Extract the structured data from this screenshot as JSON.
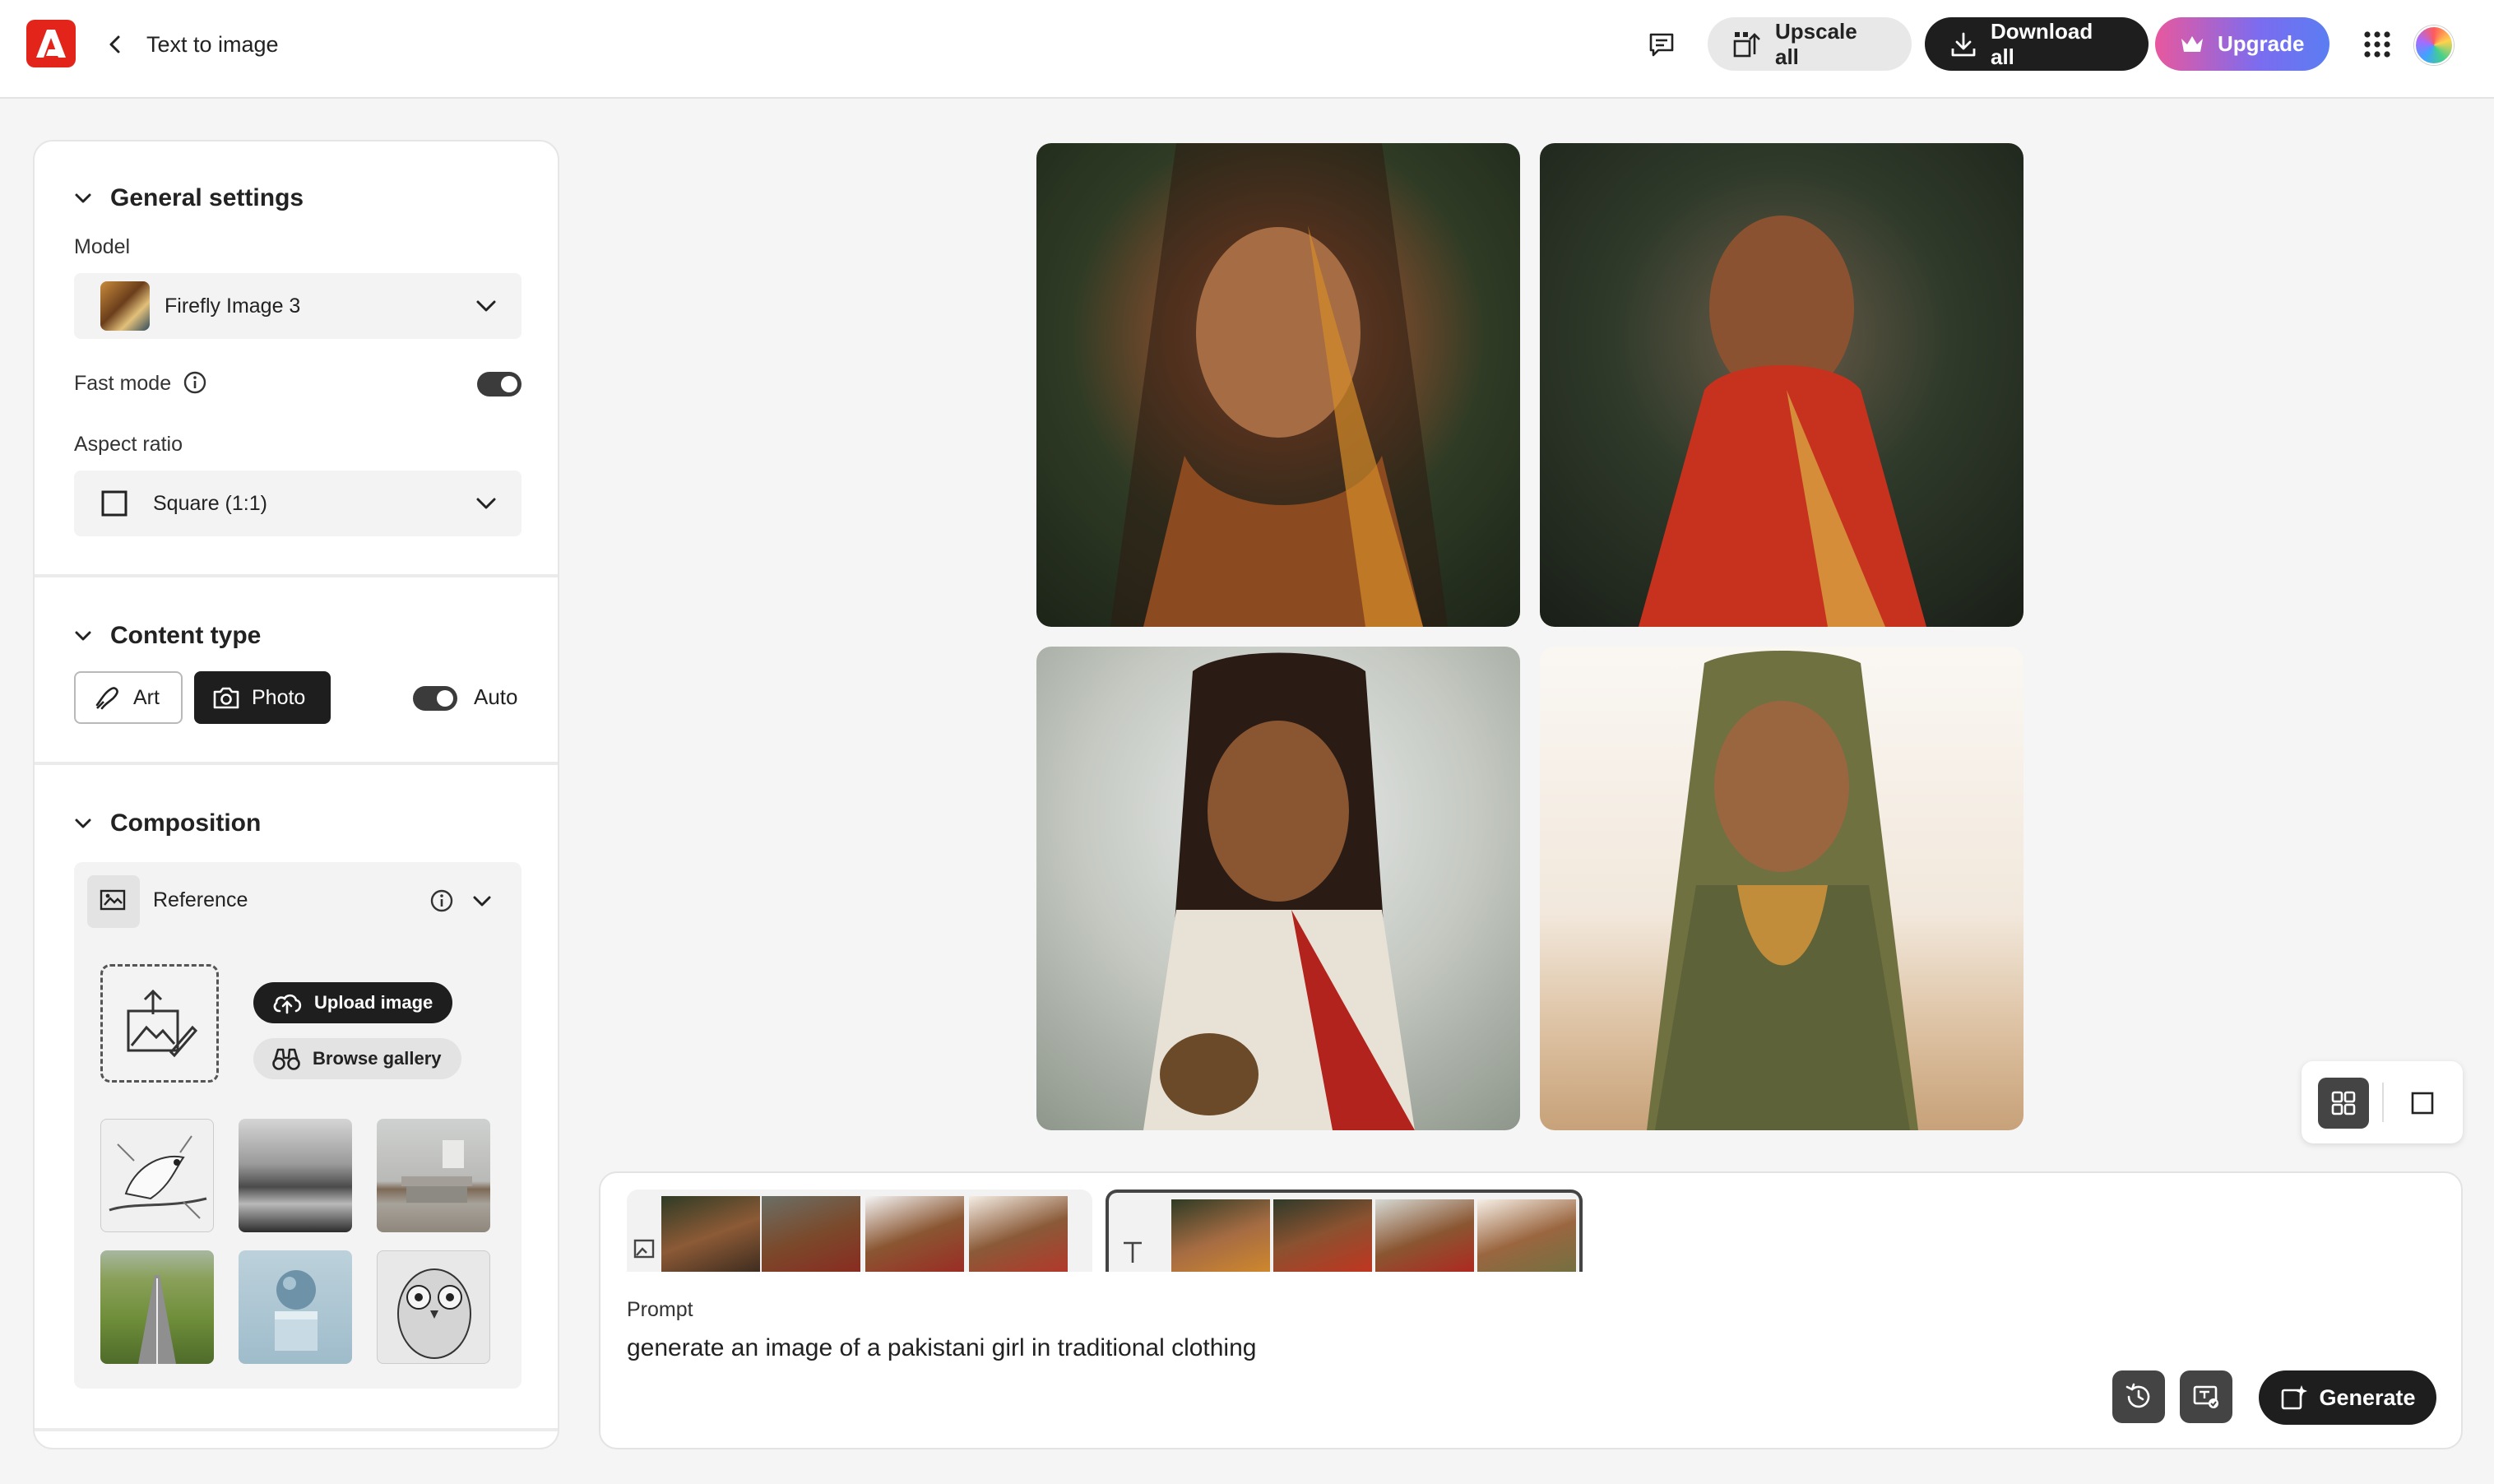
{
  "header": {
    "page_title": "Text to image",
    "upscale_label": "Upscale all",
    "download_label": "Download all",
    "upgrade_label": "Upgrade",
    "icons": [
      "adobe-logo-icon",
      "back-chevron-icon",
      "feedback-icon",
      "upscale-icon",
      "download-icon",
      "crown-icon",
      "apps-grid-icon"
    ]
  },
  "panel": {
    "general": {
      "title": "General settings",
      "model_label": "Model",
      "model_value": "Firefly Image 3",
      "fast_mode_label": "Fast mode",
      "fast_mode_on": true,
      "aspect_label": "Aspect ratio",
      "aspect_value": "Square (1:1)"
    },
    "content_type": {
      "title": "Content type",
      "art_label": "Art",
      "photo_label": "Photo",
      "selected": "Photo",
      "auto_label": "Auto",
      "auto_on": true
    },
    "composition": {
      "title": "Composition",
      "reference_label": "Reference",
      "upload_label": "Upload image",
      "browse_label": "Browse gallery",
      "style_thumbs": [
        "bird-sketch",
        "misty-landscape",
        "living-room",
        "road-field",
        "sphere-on-cube",
        "owl-sketch"
      ]
    }
  },
  "prompt": {
    "label": "Prompt",
    "text": "generate an image of a pakistani girl in traditional clothing",
    "generate_label": "Generate"
  },
  "colors": {
    "adobe_red": "#e3241b",
    "dark_button": "#1e1e1e",
    "upgrade_gradient": [
      "#e8589e",
      "#7b6cf0",
      "#5a7df2"
    ]
  },
  "view": {
    "mode": "grid"
  }
}
